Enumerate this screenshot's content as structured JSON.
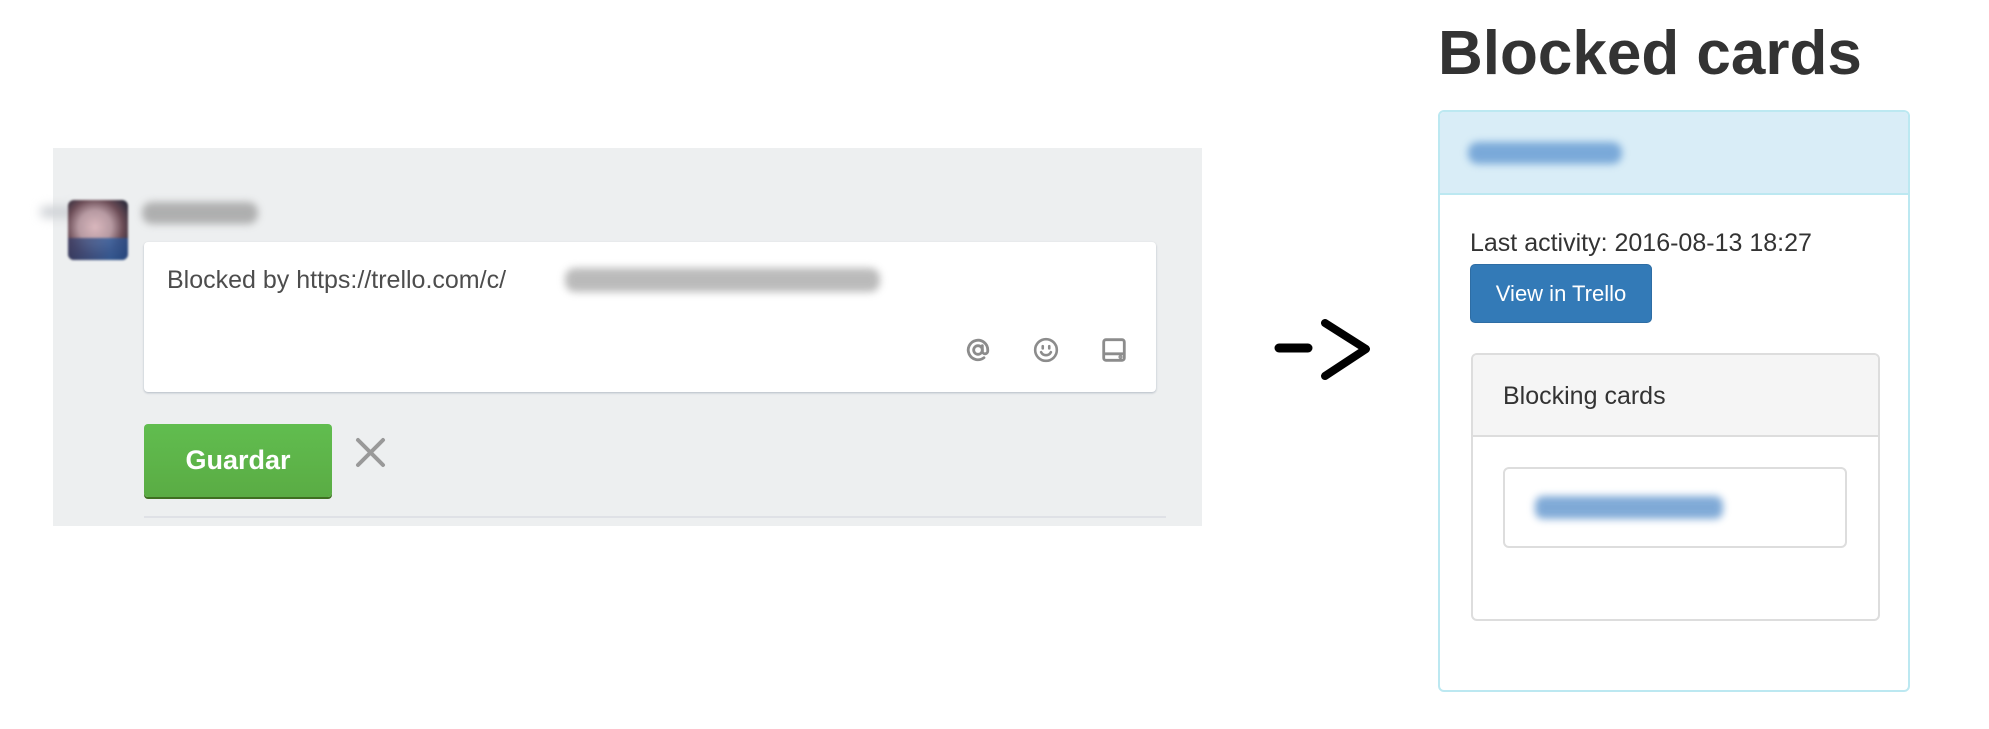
{
  "composer": {
    "author_name": "[redacted]",
    "comment_text": "Blocked by https://trello.com/c/",
    "comment_redacted_suffix": "[redacted]",
    "toolbar_icons": [
      "mention-icon",
      "emoji-icon",
      "card-icon"
    ],
    "save_label": "Guardar",
    "cancel_icon": "close-icon",
    "colors": {
      "save": "#5aac44",
      "panel_bg": "#edeff0"
    }
  },
  "arrow": {
    "label": "->"
  },
  "blocked_cards": {
    "title": "Blocked cards",
    "card": {
      "name": "[redacted]",
      "last_activity_label": "Last activity: 2016-08-13 18:27",
      "view_button_label": "View in Trello",
      "blocking": {
        "title": "Blocking cards",
        "items": [
          {
            "name": "[redacted]"
          }
        ]
      }
    },
    "colors": {
      "panel_header": "#d9edf7",
      "panel_border": "#bce8f1",
      "button": "#337ab7"
    }
  }
}
